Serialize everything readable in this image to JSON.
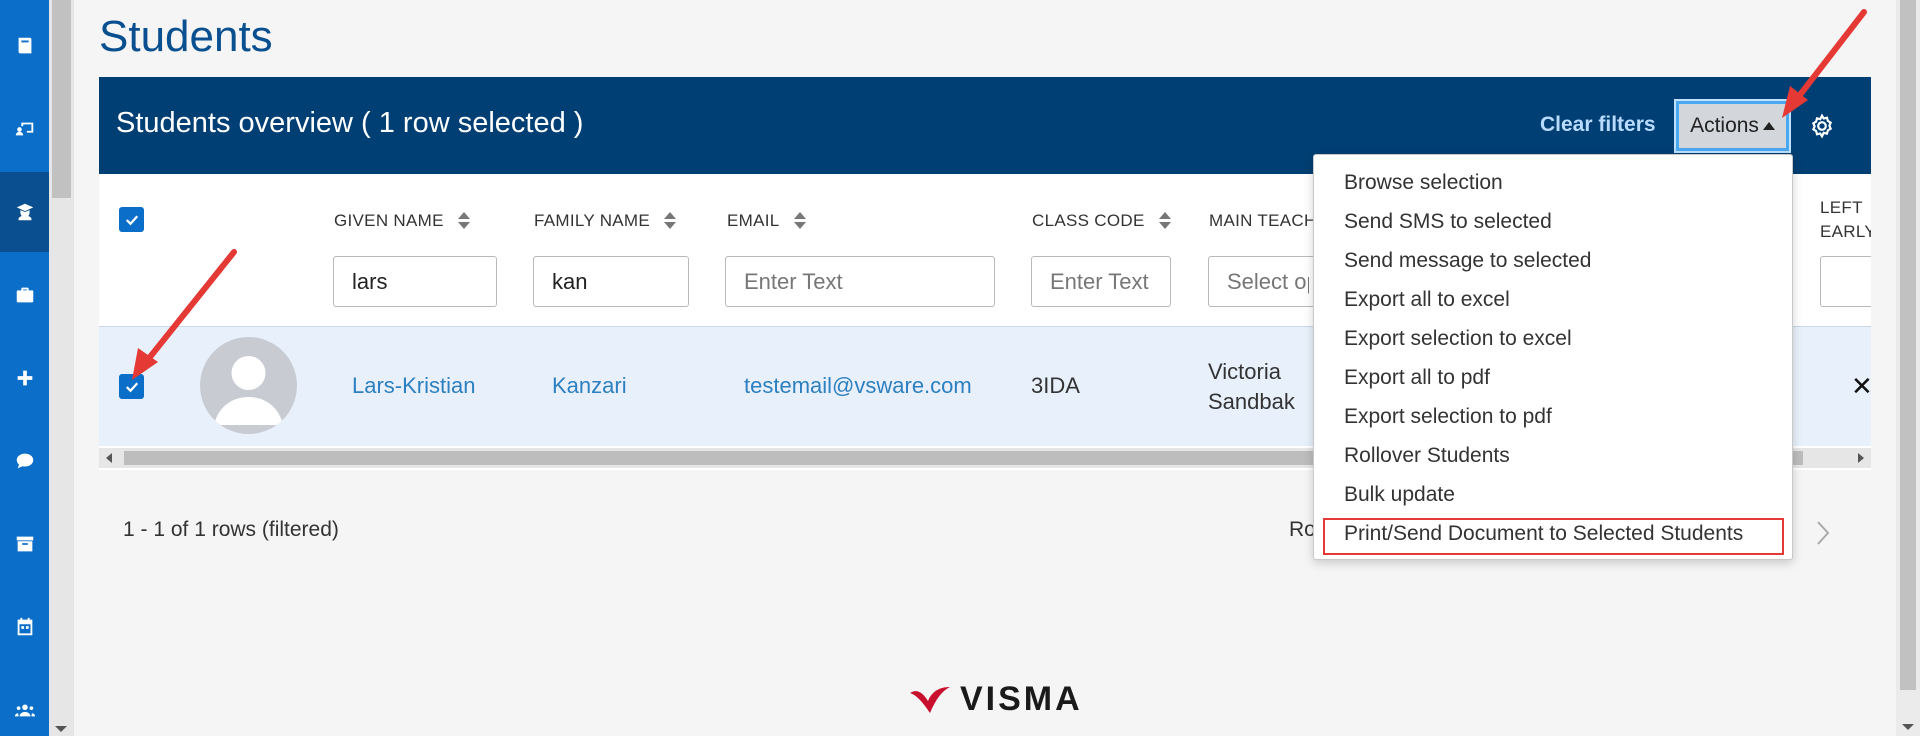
{
  "page": {
    "title": "Students"
  },
  "leftnav": {
    "items": [
      {
        "icon": "book-icon"
      },
      {
        "icon": "teacher-board-icon"
      },
      {
        "icon": "student-icon",
        "active": true
      },
      {
        "icon": "briefcase-icon"
      },
      {
        "icon": "plus-icon"
      },
      {
        "icon": "chat-icon"
      },
      {
        "icon": "archive-icon"
      },
      {
        "icon": "calendar-icon"
      },
      {
        "icon": "users-icon"
      }
    ]
  },
  "overview": {
    "title": "Students overview ( 1 row selected )",
    "clear_filters": "Clear filters",
    "actions_label": "Actions"
  },
  "columns": {
    "given_name": "GIVEN NAME",
    "family_name": "FAMILY NAME",
    "email": "EMAIL",
    "class_code": "CLASS CODE",
    "main_teacher": "MAIN TEACH",
    "left_early_1": "LEFT",
    "left_early_2": "EARLY"
  },
  "filters": {
    "given_name_value": "lars",
    "family_name_value": "kan",
    "email_placeholder": "Enter Text",
    "class_code_placeholder": "Enter Text",
    "main_teacher_placeholder": "Select op"
  },
  "row": {
    "given_name": "Lars-Kristian",
    "family_name": "Kanzari",
    "email": "testemail@vsware.com",
    "class_code": "3IDA",
    "teacher_line1": "Victoria",
    "teacher_line2": "Sandbak",
    "left_early": "✕"
  },
  "footer": {
    "rows_info": "1 - 1 of 1 rows (filtered)",
    "rows_partial": "Ro"
  },
  "actions_menu": {
    "items": [
      "Browse selection",
      "Send SMS to selected",
      "Send message to selected",
      "Export all to excel",
      "Export selection to excel",
      "Export all to pdf",
      "Export selection to pdf",
      "Rollover Students",
      "Bulk update",
      "Print/Send Document to Selected Students"
    ],
    "highlighted": "Print/Send Document to Selected Students"
  },
  "brand": {
    "logo_text": "VISMA"
  },
  "colors": {
    "nav": "#0b6fc9",
    "header": "#003f73",
    "accent": "#e53935",
    "link": "#2d7fc1"
  }
}
